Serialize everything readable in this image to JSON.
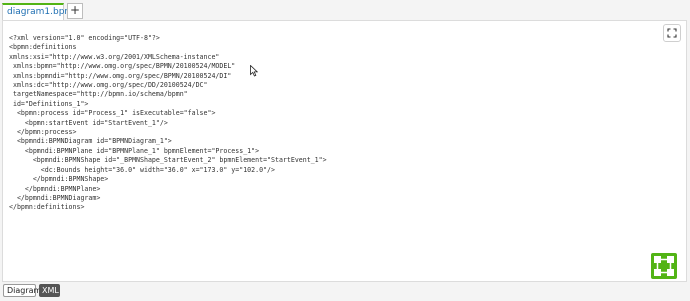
{
  "tabs": {
    "file_tab_label": "diagram1.bpmn",
    "add_tab_label": "+"
  },
  "editor": {
    "xml_lines": [
      "<?xml version=\"1.0\" encoding=\"UTF-8\"?>",
      "<bpmn:definitions",
      "xmlns:xsi=\"http://www.w3.org/2001/XMLSchema-instance\"",
      " xmlns:bpmn=\"http://www.omg.org/spec/BPMN/20100524/MODEL\"",
      " xmlns:bpmndi=\"http://www.omg.org/spec/BPMN/20100524/DI\"",
      " xmlns:dc=\"http://www.omg.org/spec/DD/20100524/DC\"",
      " targetNamespace=\"http://bpmn.io/schema/bpmn\"",
      " id=\"Definitions_1\">",
      "  <bpmn:process id=\"Process_1\" isExecutable=\"false\">",
      "    <bpmn:startEvent id=\"StartEvent_1\"/>",
      "  </bpmn:process>",
      "  <bpmndi:BPMNDiagram id=\"BPMNDiagram_1\">",
      "    <bpmndi:BPMNPlane id=\"BPMNPlane_1\" bpmnElement=\"Process_1\">",
      "      <bpmndi:BPMNShape id=\"_BPMNShape_StartEvent_2\" bpmnElement=\"StartEvent_1\">",
      "        <dc:Bounds height=\"36.0\" width=\"36.0\" x=\"173.0\" y=\"102.0\"/>",
      "      </bpmndi:BPMNShape>",
      "    </bpmndi:BPMNPlane>",
      "  </bpmndi:BPMNDiagram>",
      "</bpmn:definitions>"
    ]
  },
  "icons": {
    "fullscreen": "fullscreen-icon",
    "logo": "camunda-modeler-logo",
    "cursor": "mouse-cursor"
  },
  "bottom_tabs": {
    "diagram_label": "Diagram",
    "xml_label": "XML"
  },
  "colors": {
    "accent_green": "#52b415",
    "tab_text_blue": "#1f6fb2",
    "active_bottom_tab": "#555555"
  }
}
